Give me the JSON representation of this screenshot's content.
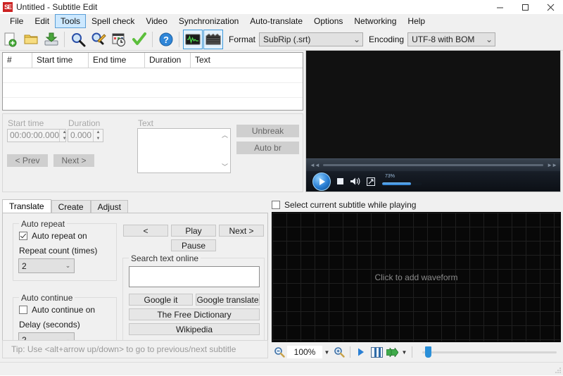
{
  "window": {
    "title": "Untitled - Subtitle Edit",
    "app_icon": "subtitle-edit-logo",
    "minimize": "minimize-icon",
    "maximize": "maximize-icon",
    "close": "close-icon"
  },
  "menu": {
    "items": [
      {
        "label": "File",
        "active": false
      },
      {
        "label": "Edit",
        "active": false
      },
      {
        "label": "Tools",
        "active": true
      },
      {
        "label": "Spell check",
        "active": false
      },
      {
        "label": "Video",
        "active": false
      },
      {
        "label": "Synchronization",
        "active": false
      },
      {
        "label": "Auto-translate",
        "active": false
      },
      {
        "label": "Options",
        "active": false
      },
      {
        "label": "Networking",
        "active": false
      },
      {
        "label": "Help",
        "active": false
      }
    ]
  },
  "toolbar": {
    "buttons": [
      {
        "name": "new-subtitle-icon",
        "checked": false
      },
      {
        "name": "open-subtitle-icon",
        "checked": false
      },
      {
        "name": "save-subtitle-icon",
        "checked": false
      },
      {
        "name": "find-icon",
        "checked": false
      },
      {
        "name": "replace-icon",
        "checked": false
      },
      {
        "name": "fix-common-errors-icon",
        "checked": false
      },
      {
        "name": "spell-check-icon",
        "checked": false
      },
      {
        "name": "help-icon",
        "checked": false
      },
      {
        "name": "toggle-waveform-icon",
        "checked": true
      },
      {
        "name": "toggle-video-icon",
        "checked": true
      }
    ],
    "format_label": "Format",
    "format_value": "SubRip (.srt)",
    "encoding_label": "Encoding",
    "encoding_value": "UTF-8 with BOM"
  },
  "grid": {
    "columns": [
      "#",
      "Start time",
      "End time",
      "Duration",
      "Text"
    ],
    "rows": []
  },
  "edit_panel": {
    "start_time_label": "Start time",
    "start_time_value": "00:00:00.000",
    "duration_label": "Duration",
    "duration_value": "0.000",
    "text_label": "Text",
    "text_value": "",
    "prev_button": "< Prev",
    "next_button": "Next >",
    "unbreak_button": "Unbreak",
    "autobr_button": "Auto br",
    "autobr_accesskey": "b"
  },
  "video": {
    "play_icon": "play-icon",
    "stop_icon": "stop-icon",
    "volume_icon": "volume-icon",
    "fullscreen_icon": "fullscreen-icon",
    "volume_text": "73%",
    "volume_percent": 73,
    "seek_back_icon": "seek-back-icon",
    "seek_forward_icon": "seek-forward-icon"
  },
  "tabs": {
    "items": [
      {
        "label": "Translate",
        "active": true
      },
      {
        "label": "Create",
        "active": false
      },
      {
        "label": "Adjust",
        "active": false
      }
    ]
  },
  "translate_tab": {
    "auto_repeat": {
      "group_title": "Auto repeat",
      "checkbox_label": "Auto repeat on",
      "checkbox_checked": true,
      "count_label": "Repeat count (times)",
      "count_value": "2"
    },
    "auto_continue": {
      "group_title": "Auto continue",
      "checkbox_label": "Auto continue on",
      "checkbox_checked": false,
      "delay_label": "Delay (seconds)",
      "delay_value": "2"
    },
    "playback": {
      "prev_button": "<",
      "play_button": "Play",
      "play_accesskey": "P",
      "next_button": "Next >",
      "next_accesskey": "N",
      "pause_button": "Pause"
    },
    "search": {
      "group_title": "Search text online",
      "input_value": "",
      "google_it_button": "Google it",
      "google_translate_button": "Google translate",
      "free_dictionary_button": "The Free Dictionary",
      "wikipedia_button": "Wikipedia"
    }
  },
  "tip": "Tip: Use <alt+arrow up/down> to go to previous/next subtitle",
  "waveform": {
    "select_checkbox_label": "Select current subtitle while playing",
    "select_checkbox_checked": false,
    "placeholder": "Click to add waveform",
    "zoom_out_icon": "zoom-out-icon",
    "zoom_value": "100%",
    "zoom_in_icon": "zoom-in-icon",
    "play_icon": "play-icon",
    "split_icon": "split-view-icon",
    "fast_forward_icon": "fast-forward-icon",
    "dropdown_icon": "chevron-down-icon",
    "volume_slider_percent": 2
  },
  "colors": {
    "accent": "#3c99dc",
    "menu_highlight": "#cce8ff",
    "window_bg": "#f0f0f0",
    "waveform_bg": "#080808",
    "logo_red": "#cc2222"
  }
}
